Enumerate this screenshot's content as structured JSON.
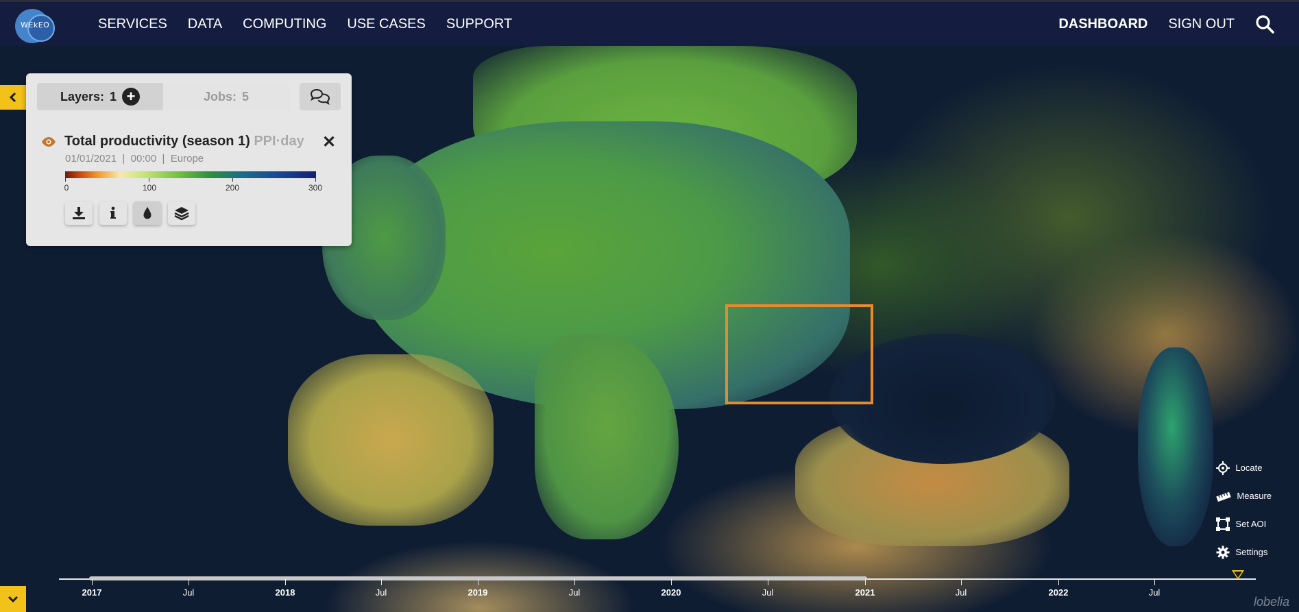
{
  "brand": {
    "logo_text": "WEkEO"
  },
  "nav": {
    "items": [
      {
        "label": "SERVICES"
      },
      {
        "label": "DATA"
      },
      {
        "label": "COMPUTING"
      },
      {
        "label": "USE CASES"
      },
      {
        "label": "SUPPORT"
      }
    ],
    "dashboard": "DASHBOARD",
    "sign_out": "SIGN OUT",
    "search_icon": "search-icon"
  },
  "panel": {
    "layers_label": "Layers:",
    "layers_count": "1",
    "jobs_label": "Jobs:",
    "jobs_count": "5",
    "layer": {
      "title": "Total productivity (season 1)",
      "unit": "PPI·day",
      "date": "01/01/2021",
      "time": "00:00",
      "region": "Europe",
      "colorbar_ticks": [
        "0",
        "100",
        "200",
        "300"
      ]
    },
    "tools": [
      "download-icon",
      "info-icon",
      "drop-icon",
      "layers-icon"
    ]
  },
  "map_tools": {
    "locate": "Locate",
    "measure": "Measure",
    "set_aoi": "Set AOI",
    "settings": "Settings"
  },
  "timeline": {
    "labels": [
      "2017",
      "Jul",
      "2018",
      "Jul",
      "2019",
      "Jul",
      "2020",
      "Jul",
      "2021",
      "Jul",
      "2022",
      "Jul"
    ],
    "selected": "2021"
  },
  "colors": {
    "accent": "#f2c21b",
    "nav_bg": "#141d3f",
    "aoi": "#e68a2e"
  },
  "watermark": "lobelia"
}
